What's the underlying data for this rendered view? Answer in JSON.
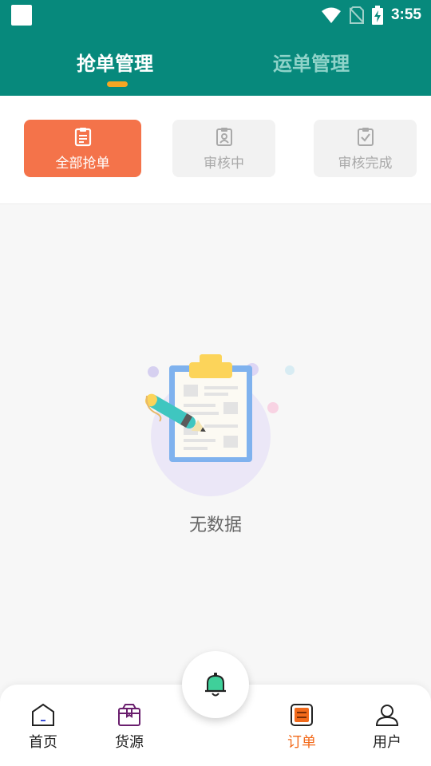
{
  "status_bar": {
    "time": "3:55",
    "icons": [
      "app-icon",
      "wifi-icon",
      "no-sim-icon",
      "battery-charging-icon"
    ]
  },
  "header": {
    "tabs": [
      {
        "label": "抢单管理",
        "active": true
      },
      {
        "label": "运单管理",
        "active": false
      }
    ],
    "background": "#07897c",
    "indicator_color": "#f5a623"
  },
  "filters": [
    {
      "label": "全部抢单",
      "icon": "clipboard-list-icon",
      "active": true
    },
    {
      "label": "审核中",
      "icon": "clipboard-user-icon",
      "active": false
    },
    {
      "label": "审核完成",
      "icon": "clipboard-check-icon",
      "active": false
    }
  ],
  "empty_state": {
    "message": "无数据",
    "illustration": "clipboard-pen-illustration"
  },
  "bottom_nav": {
    "items": [
      {
        "label": "首页",
        "icon": "home-icon",
        "active": false
      },
      {
        "label": "货源",
        "icon": "package-icon",
        "active": false
      },
      {
        "label": "订单",
        "icon": "order-icon",
        "active": true
      },
      {
        "label": "用户",
        "icon": "user-icon",
        "active": false
      }
    ],
    "center_icon": "bell-icon",
    "active_color": "#f26a1b"
  }
}
